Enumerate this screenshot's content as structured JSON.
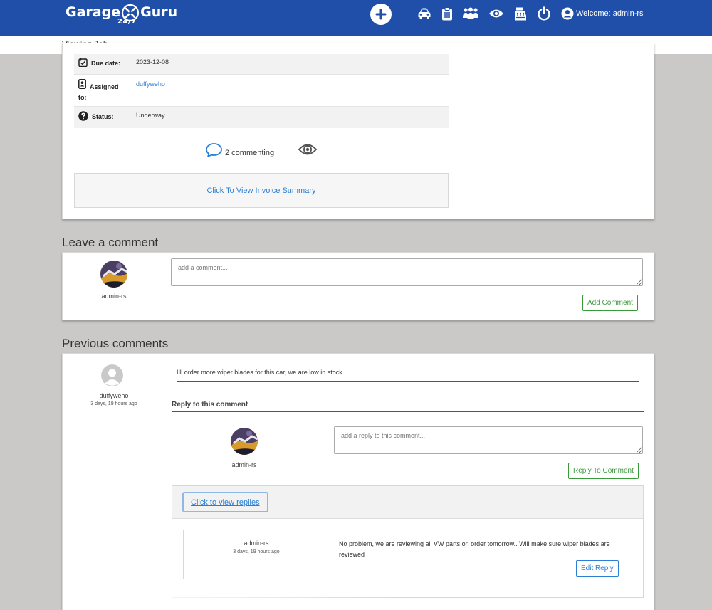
{
  "header": {
    "logo_text_1": "Garage",
    "logo_text_2": "Guru",
    "logo_tag": "24/7",
    "welcome": "Welcome: admin-rs",
    "icons": [
      "plus-circle-icon",
      "car-icon",
      "clipboard-icon",
      "users-icon",
      "eye-icon",
      "cash-register-icon",
      "power-icon",
      "user-circle-icon"
    ]
  },
  "subheader": {
    "title": "Viewing Job"
  },
  "job": {
    "due_label": "Due date:",
    "due_value": "2023-12-08",
    "assigned_label_1": "Assigned",
    "assigned_label_2": "to:",
    "assigned_value": "duffyweho",
    "status_label": "Status:",
    "status_value": "Underway",
    "commenting": "2 commenting",
    "invoice_link": "Click To View Invoice Summary"
  },
  "leave_comment": {
    "title": "Leave a comment",
    "user": "admin-rs",
    "placeholder": "add a comment...",
    "button": "Add Comment"
  },
  "previous_comments": {
    "title": "Previous comments",
    "comment": {
      "author": "duffyweho",
      "time": "3 days, 19 hours ago",
      "text": "I'll order more wiper blades for this car, we are low in stock"
    },
    "reply_heading": "Reply to this comment",
    "reply_user": "admin-rs",
    "reply_placeholder": "add a reply to this comment...",
    "reply_button": "Reply To Comment",
    "view_replies": "Click to view replies",
    "reply": {
      "author": "admin-rs",
      "time": "3 days, 19 hours ago",
      "text": "No problem, we are reviewing all VW parts on order tomorrow.. Will make sure wiper blades are reviewed",
      "edit_button": "Edit Reply"
    }
  },
  "colors": {
    "header_bg": "#1f4fa8",
    "page_bg": "#cbc8c8",
    "link": "#2a7fd4",
    "success": "#3a9a3a"
  }
}
